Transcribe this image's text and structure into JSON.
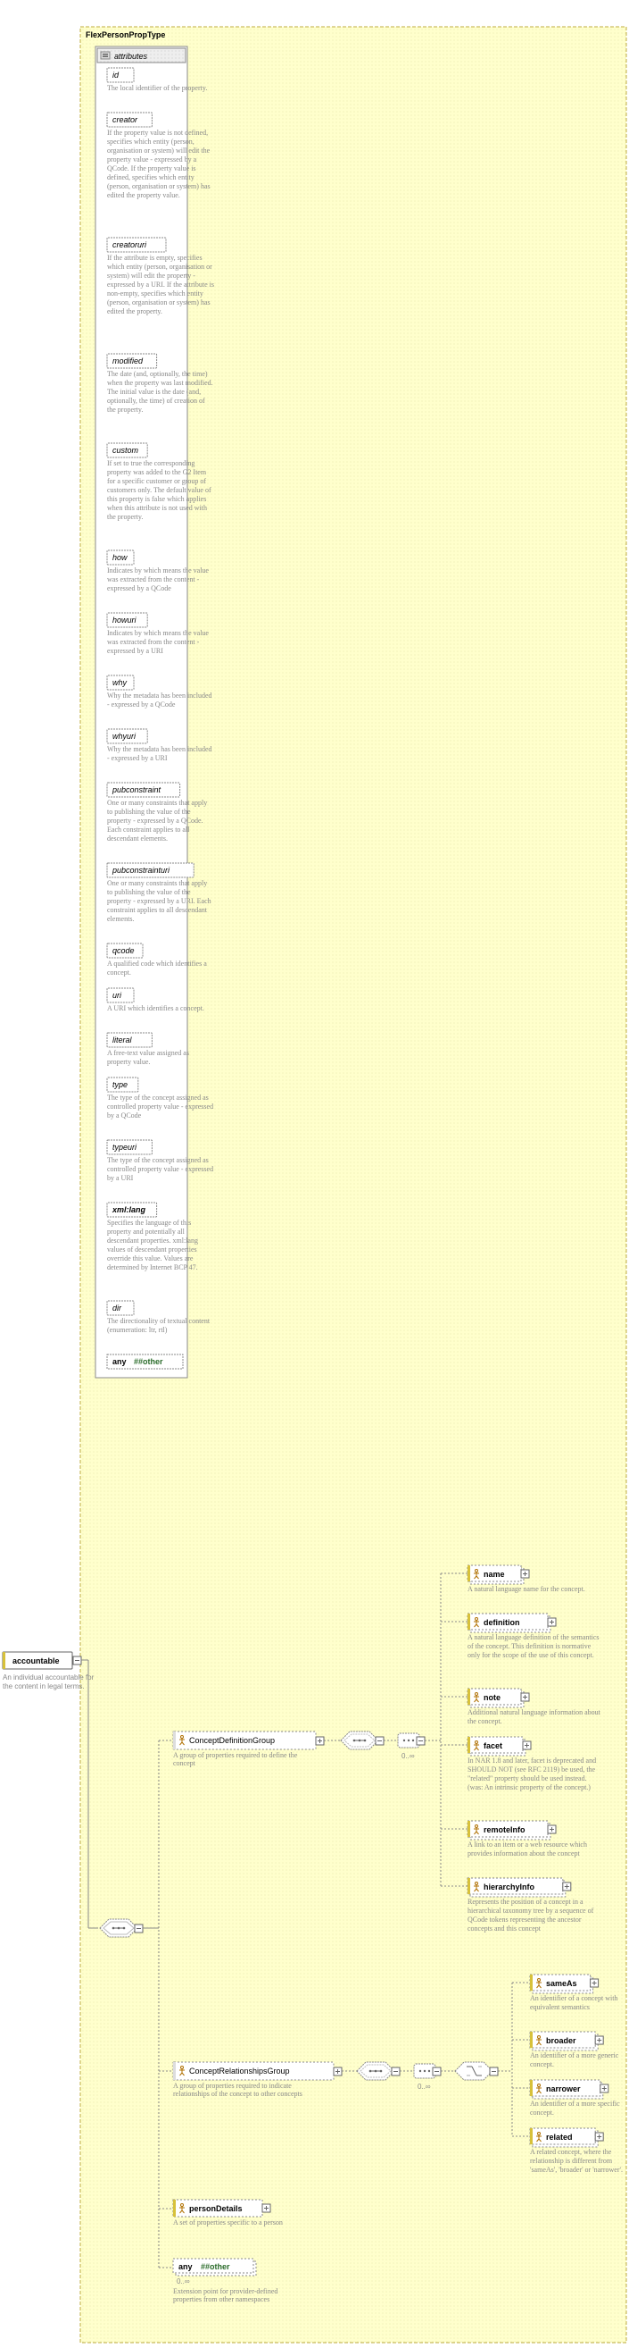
{
  "title": "FlexPersonPropType",
  "root": {
    "name": "accountable",
    "desc": "An individual accountable for the content in legal terms."
  },
  "attributesHeader": "attributes",
  "anyOther": {
    "any": "any",
    "hash": "##other"
  },
  "attrs": [
    {
      "name": "id",
      "desc": "The local identifier of the property."
    },
    {
      "name": "creator",
      "desc": "If the property value is not defined, specifies which entity (person, organisation or system) will edit the property value - expressed by a QCode. If the property value is defined, specifies which entity (person, organisation or system) has edited the property value."
    },
    {
      "name": "creatoruri",
      "desc": "If the attribute is empty, specifies which entity (person, organisation or system) will edit the property - expressed by a URI. If the attribute is non-empty, specifies which entity (person, organisation or system) has edited the property."
    },
    {
      "name": "modified",
      "desc": "The date (and, optionally, the time) when the property was last modified. The initial value is the date (and, optionally, the time) of creation of the property."
    },
    {
      "name": "custom",
      "desc": "If set to true the corresponding property was added to the G2 Item for a specific customer or group of customers only. The default value of this property is false which applies when this attribute is not used with the property."
    },
    {
      "name": "how",
      "desc": "Indicates by which means the value was extracted from the content - expressed by a QCode"
    },
    {
      "name": "howuri",
      "desc": "Indicates by which means the value was extracted from the content - expressed by a URI"
    },
    {
      "name": "why",
      "desc": "Why the metadata has been included - expressed by a QCode"
    },
    {
      "name": "whyuri",
      "desc": "Why the metadata has been included - expressed by a URI"
    },
    {
      "name": "pubconstraint",
      "desc": "One or many constraints that apply to publishing the value of the property - expressed by a QCode. Each constraint applies to all descendant elements."
    },
    {
      "name": "pubconstrainturi",
      "desc": "One or many constraints that apply to publishing the value of the property - expressed by a URI. Each constraint applies to all descendant elements."
    },
    {
      "name": "qcode",
      "desc": "A qualified code which identifies a concept."
    },
    {
      "name": "uri",
      "desc": "A URI which identifies a concept."
    },
    {
      "name": "literal",
      "desc": "A free-text value assigned as property value."
    },
    {
      "name": "type",
      "desc": "The type of the concept assigned as controlled property value - expressed by a QCode"
    },
    {
      "name": "typeuri",
      "desc": "The type of the concept assigned as controlled property value - expressed by a URI"
    },
    {
      "name": "xml:lang",
      "desc": "Specifies the language of this property and potentially all descendant properties. xml:lang values of descendant properties override this value. Values are determined by Internet BCP 47."
    },
    {
      "name": "dir",
      "desc": "The directionality of textual content (enumeration: ltr, rtl)"
    }
  ],
  "groups": {
    "cdg": {
      "title": "ConceptDefinitionGroup",
      "desc": "A group of properties required to define the concept"
    },
    "crg": {
      "title": "ConceptRelationshipsGroup",
      "desc": "A group of properties required to indicate relationships of the concept to other concepts"
    }
  },
  "cdgChildren": [
    {
      "name": "name",
      "desc": "A natural language name for the concept."
    },
    {
      "name": "definition",
      "desc": "A natural language definition of the semantics of the concept. This definition is normative only for the scope of the use of this concept."
    },
    {
      "name": "note",
      "desc": "Additional natural language information about the concept."
    },
    {
      "name": "facet",
      "desc": "In NAR 1.8 and later, facet is deprecated and SHOULD NOT (see RFC 2119) be used, the \"related\" property should be used instead.(was: An intrinsic property of the concept.)"
    },
    {
      "name": "remoteInfo",
      "desc": "A link to an item or a web resource which provides information about the concept"
    },
    {
      "name": "hierarchyInfo",
      "desc": "Represents the position of a concept in a hierarchical taxonomy tree by a sequence of QCode tokens representing the ancestor concepts and this concept"
    }
  ],
  "crgChildren": [
    {
      "name": "sameAs",
      "desc": "An identifier of a concept with equivalent semantics"
    },
    {
      "name": "broader",
      "desc": "An identifier of a more generic concept."
    },
    {
      "name": "narrower",
      "desc": "An identifier of a more specific concept."
    },
    {
      "name": "related",
      "desc": "A related concept, where the relationship is different from 'sameAs', 'broader' or 'narrower'."
    }
  ],
  "personDetails": {
    "name": "personDetails",
    "desc": "A set of properties specific to a person"
  },
  "anyExt": {
    "any": "any",
    "hash": "##other",
    "card": "0..∞",
    "desc": "Extension point for provider-defined properties from other namespaces"
  },
  "cardinality": "0..∞"
}
